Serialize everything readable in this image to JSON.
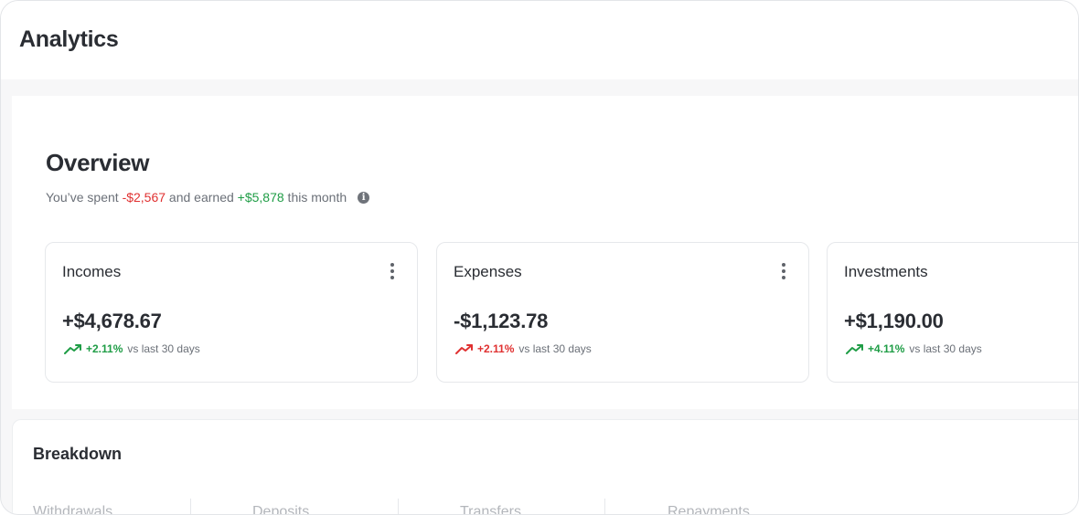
{
  "header": {
    "title": "Analytics"
  },
  "overview": {
    "title": "Overview",
    "summary": {
      "prefix": "You’ve spent ",
      "spent": "-$2,567",
      "middle": " and earned ",
      "earned": "+$5,878",
      "suffix": " this month"
    },
    "info_icon": "info-icon",
    "cards": [
      {
        "label": "Incomes",
        "amount": "+$4,678.67",
        "change": "+2.11%",
        "direction": "up",
        "color": "#1f9d46",
        "comparison": "vs last 30 days",
        "menu_icon": "more-vertical-icon"
      },
      {
        "label": "Expenses",
        "amount": "-$1,123.78",
        "change": "+2.11%",
        "direction": "up",
        "color": "#e03131",
        "comparison": "vs last 30 days",
        "menu_icon": "more-vertical-icon"
      },
      {
        "label": "Investments",
        "amount": "+$1,190.00",
        "change": "+4.11%",
        "direction": "up",
        "color": "#1f9d46",
        "comparison": "vs last 30 days",
        "menu_icon": "more-vertical-icon"
      }
    ]
  },
  "breakdown": {
    "title": "Breakdown",
    "tabs": [
      "Withdrawals",
      "Deposits",
      "Transfers",
      "Repayments"
    ]
  },
  "colors": {
    "negative": "#e03131",
    "positive": "#1f9d46",
    "text": "#2a2d33",
    "muted": "#6b7078"
  }
}
